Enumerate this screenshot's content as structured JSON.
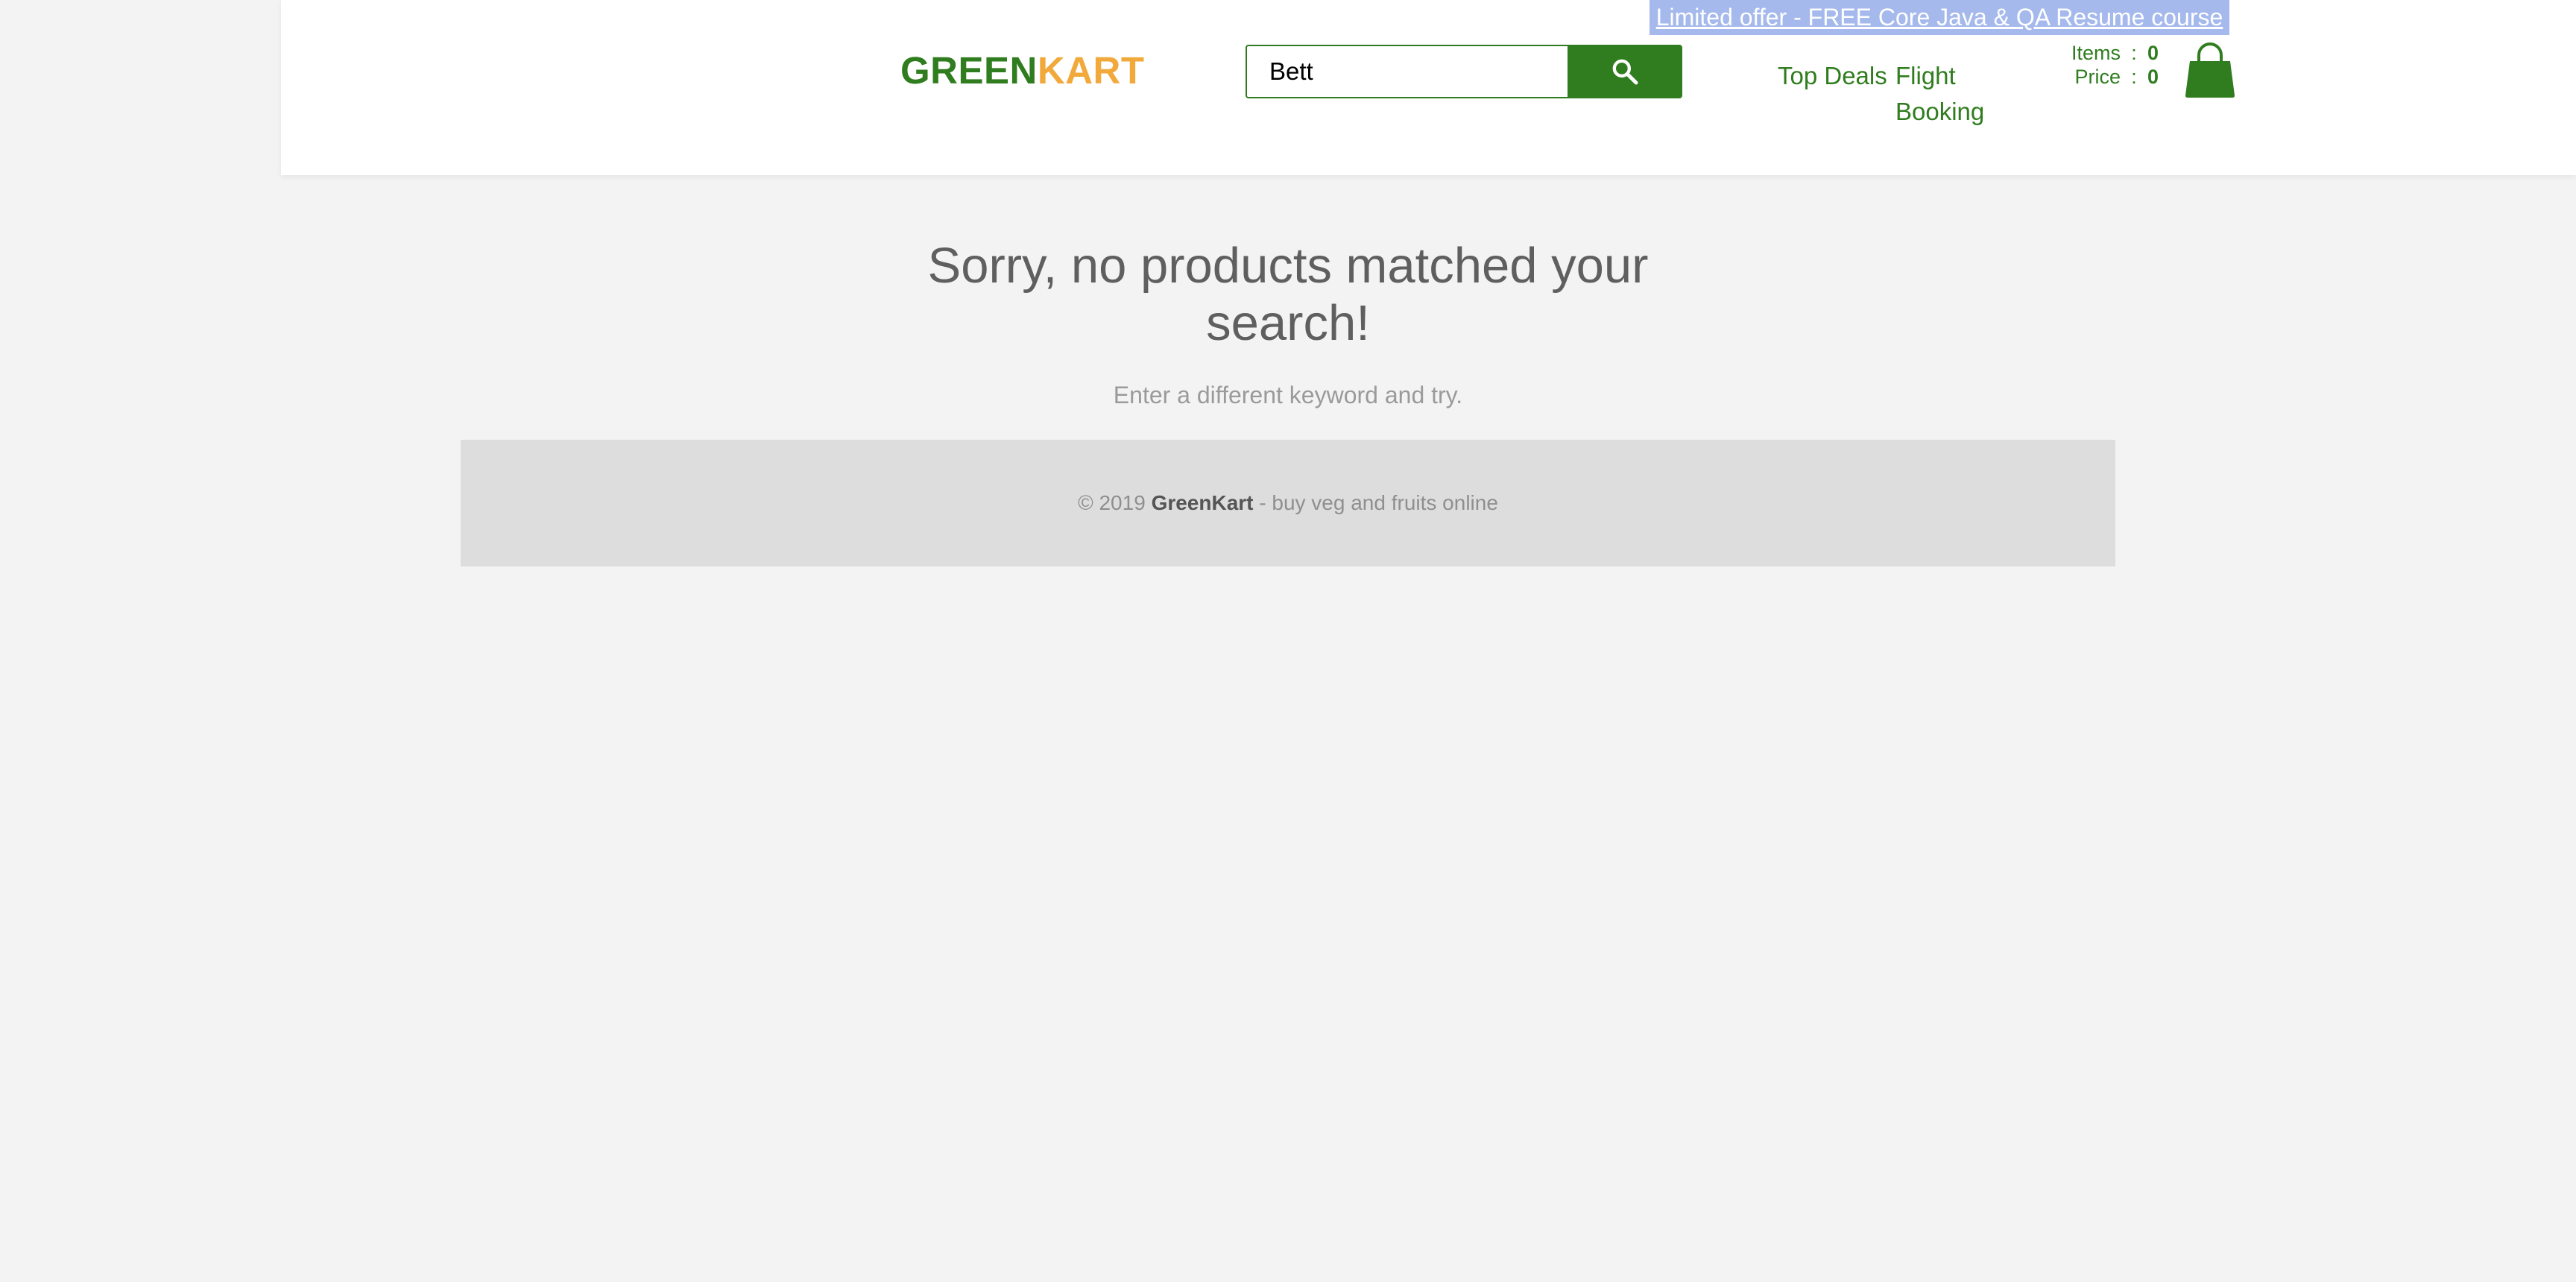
{
  "promo": {
    "text": "Limited offer - FREE Core Java & QA Resume course"
  },
  "brand": {
    "part1": "GREEN",
    "part2": "KART"
  },
  "search": {
    "value": "Bett",
    "button_icon": "search-icon"
  },
  "nav": {
    "top_deals": "Top Deals",
    "flight_booking": "Flight Booking"
  },
  "cart": {
    "items_label": "Items",
    "items_value": "0",
    "price_label": "Price",
    "price_value": "0",
    "separator": ":",
    "icon": "shopping-bag-icon"
  },
  "empty": {
    "title": "Sorry, no products matched your search!",
    "subtitle": "Enter a different keyword and try."
  },
  "footer": {
    "prefix": "© 2019 ",
    "brand": "GreenKart",
    "suffix": " - buy veg and fruits online"
  },
  "colors": {
    "brand_green": "#2f7d1e",
    "brand_orange": "#f2a93b",
    "promo_bg": "#a5b9ec",
    "page_bg": "#f3f3f3"
  }
}
